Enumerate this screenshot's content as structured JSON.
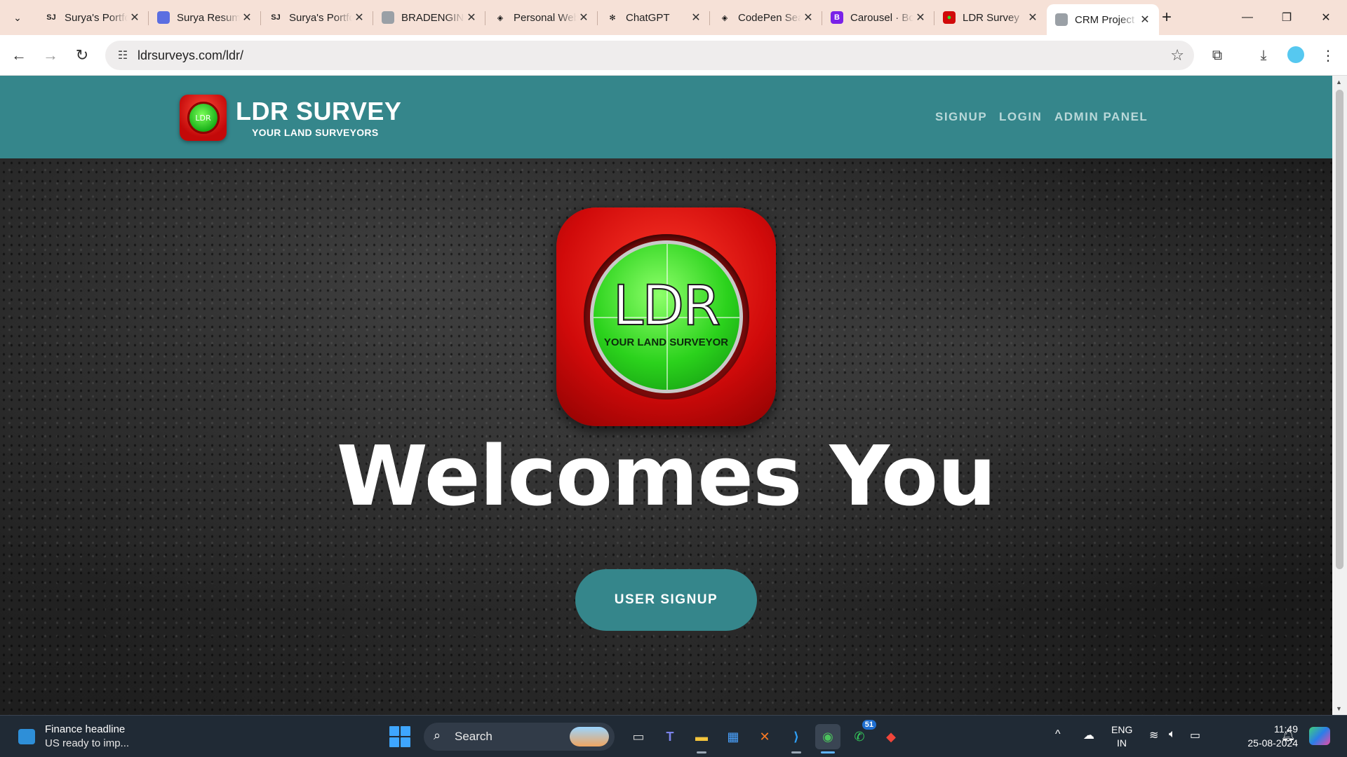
{
  "browser": {
    "tabs": [
      {
        "title": "Surya's Portfolio",
        "favicon": "SJ",
        "favicon_color": "#f6e1d7",
        "favicon_text_color": "#222222"
      },
      {
        "title": "Surya Resume",
        "favicon": "",
        "favicon_color": "#5b6ee1",
        "favicon_text_color": "#ffffff"
      },
      {
        "title": "Surya's Portfolio",
        "favicon": "SJ",
        "favicon_color": "#f6e1d7",
        "favicon_text_color": "#222222"
      },
      {
        "title": "BRADENGINEERING",
        "favicon": "",
        "favicon_color": "#9aa0a6",
        "favicon_text_color": "#ffffff"
      },
      {
        "title": "Personal Website",
        "favicon": "◈",
        "favicon_color": "#f6e1d7",
        "favicon_text_color": "#111111"
      },
      {
        "title": "ChatGPT",
        "favicon": "✻",
        "favicon_color": "#f6e1d7",
        "favicon_text_color": "#111111"
      },
      {
        "title": "CodePen Search",
        "favicon": "◈",
        "favicon_color": "#f6e1d7",
        "favicon_text_color": "#111111"
      },
      {
        "title": "Carousel · Bootstrap",
        "favicon": "B",
        "favicon_color": "#7a22e8",
        "favicon_text_color": "#ffffff"
      },
      {
        "title": "LDR Survey",
        "favicon": "●",
        "favicon_color": "#d10a0a",
        "favicon_text_color": "#2ee02e"
      },
      {
        "title": "CRM Project",
        "favicon": "",
        "favicon_color": "#9aa0a6",
        "favicon_text_color": "#ffffff",
        "active": true
      }
    ],
    "new_tab": "+",
    "window_controls": {
      "minimize": "—",
      "restore": "❐",
      "close": "✕"
    },
    "address": {
      "url": "ldrsurveys.com/ldr/"
    },
    "nav": {
      "back": "←",
      "forward": "→",
      "reload": "↻"
    },
    "toolbar_icons": {
      "extensions": "⧉",
      "download": "⤓",
      "menu": "⋮",
      "bookmark": "☆",
      "site_info": "☷"
    }
  },
  "site": {
    "brand_name": "LDR SURVEY",
    "brand_tagline": "YOUR LAND SURVEYORS",
    "logo_small_text": "LDR",
    "nav": [
      {
        "label": "SIGNUP"
      },
      {
        "label": "LOGIN"
      },
      {
        "label": "ADMIN PANEL"
      }
    ],
    "hero_logo_text": "LDR",
    "hero_logo_sub": "YOUR LAND SURVEYOR",
    "headline": "Welcomes You",
    "cta": "USER SIGNUP",
    "colors": {
      "header": "#35868b",
      "button": "#35868b",
      "logo_red": "#d00a0a",
      "logo_green": "#2bd21c"
    }
  },
  "taskbar": {
    "news_title": "Finance headline",
    "news_sub": "US ready to imp...",
    "search_label": "Search",
    "apps": [
      {
        "name": "task-view",
        "glyph": "▭"
      },
      {
        "name": "teams",
        "glyph": "T"
      },
      {
        "name": "file-explorer",
        "glyph": "▬"
      },
      {
        "name": "microsoft-store",
        "glyph": "▦"
      },
      {
        "name": "xampp",
        "glyph": "✕"
      },
      {
        "name": "vscode",
        "glyph": "⟩"
      },
      {
        "name": "chrome",
        "glyph": "◉",
        "active": true
      },
      {
        "name": "whatsapp",
        "glyph": "✆",
        "badge": "51"
      },
      {
        "name": "git",
        "glyph": "◆"
      }
    ],
    "tray": {
      "chevron": "^",
      "lang": "ENG",
      "region": "IN",
      "time": "11:49",
      "date": "25-08-2024"
    }
  }
}
